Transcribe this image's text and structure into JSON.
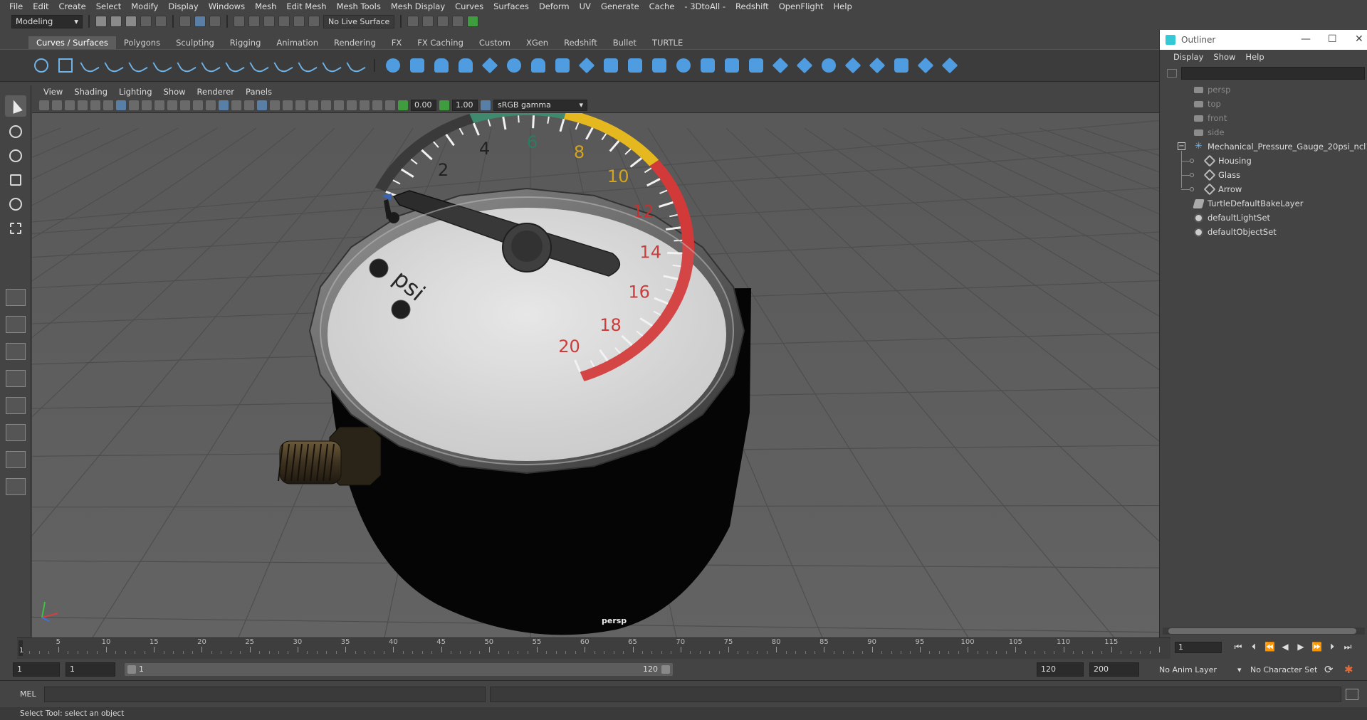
{
  "menubar": [
    "File",
    "Edit",
    "Create",
    "Select",
    "Modify",
    "Display",
    "Windows",
    "Mesh",
    "Edit Mesh",
    "Mesh Tools",
    "Mesh Display",
    "Curves",
    "Surfaces",
    "Deform",
    "UV",
    "Generate",
    "Cache",
    "- 3DtoAll -",
    "Redshift",
    "OpenFlight",
    "Help"
  ],
  "statusline": {
    "mode": "Modeling",
    "live_surface": "No Live Surface"
  },
  "shelf_tabs": [
    "Curves / Surfaces",
    "Polygons",
    "Sculpting",
    "Rigging",
    "Animation",
    "Rendering",
    "FX",
    "FX Caching",
    "Custom",
    "XGen",
    "Redshift",
    "Bullet",
    "TURTLE"
  ],
  "active_shelf": "Curves / Surfaces",
  "viewport": {
    "menu": [
      "View",
      "Shading",
      "Lighting",
      "Show",
      "Renderer",
      "Panels"
    ],
    "exposure": "0.00",
    "gamma": "1.00",
    "color_management": "sRGB gamma",
    "camera": "persp",
    "gauge": {
      "unit": "psi",
      "dial_labels": [
        "2",
        "4",
        "6",
        "8",
        "10",
        "12",
        "14",
        "16",
        "18",
        "20"
      ],
      "needle_value": 1.5,
      "zone_colors": {
        "neutral": "#3a3a3a",
        "green": "#3f8a6f",
        "yellow": "#e6b820",
        "red": "#d23a3a"
      }
    }
  },
  "outliner": {
    "title": "Outliner",
    "menu": [
      "Display",
      "Show",
      "Help"
    ],
    "items": [
      {
        "label": "persp",
        "type": "camera",
        "indent": 1,
        "dim": true
      },
      {
        "label": "top",
        "type": "camera",
        "indent": 1,
        "dim": true
      },
      {
        "label": "front",
        "type": "camera",
        "indent": 1,
        "dim": true
      },
      {
        "label": "side",
        "type": "camera",
        "indent": 1,
        "dim": true
      },
      {
        "label": "Mechanical_Pressure_Gauge_20psi_ncl1_1",
        "type": "group",
        "indent": 1,
        "dim": false,
        "expanded": true
      },
      {
        "label": "Housing",
        "type": "mesh",
        "indent": 2,
        "dim": false
      },
      {
        "label": "Glass",
        "type": "mesh",
        "indent": 2,
        "dim": false
      },
      {
        "label": "Arrow",
        "type": "mesh",
        "indent": 2,
        "dim": false
      },
      {
        "label": "TurtleDefaultBakeLayer",
        "type": "layer",
        "indent": 1,
        "dim": false
      },
      {
        "label": "defaultLightSet",
        "type": "set",
        "indent": 1,
        "dim": false
      },
      {
        "label": "defaultObjectSet",
        "type": "set",
        "indent": 1,
        "dim": false
      }
    ]
  },
  "timeline": {
    "labels": [
      "5",
      "10",
      "15",
      "20",
      "25",
      "30",
      "35",
      "40",
      "45",
      "50",
      "55",
      "60",
      "65",
      "70",
      "75",
      "80",
      "85",
      "90",
      "95",
      "100",
      "105",
      "110",
      "115"
    ],
    "start": 1,
    "end": 120,
    "current_frame": "1",
    "current_frame_field": "1"
  },
  "range": {
    "start_time": "1",
    "start_range": "1",
    "slider_start": "1",
    "slider_end": "120",
    "end_range": "120",
    "end_time": "200",
    "anim_layer": "No Anim Layer",
    "character_set": "No Character Set"
  },
  "cmdline": {
    "label": "MEL"
  },
  "helpline": "Select Tool: select an object"
}
